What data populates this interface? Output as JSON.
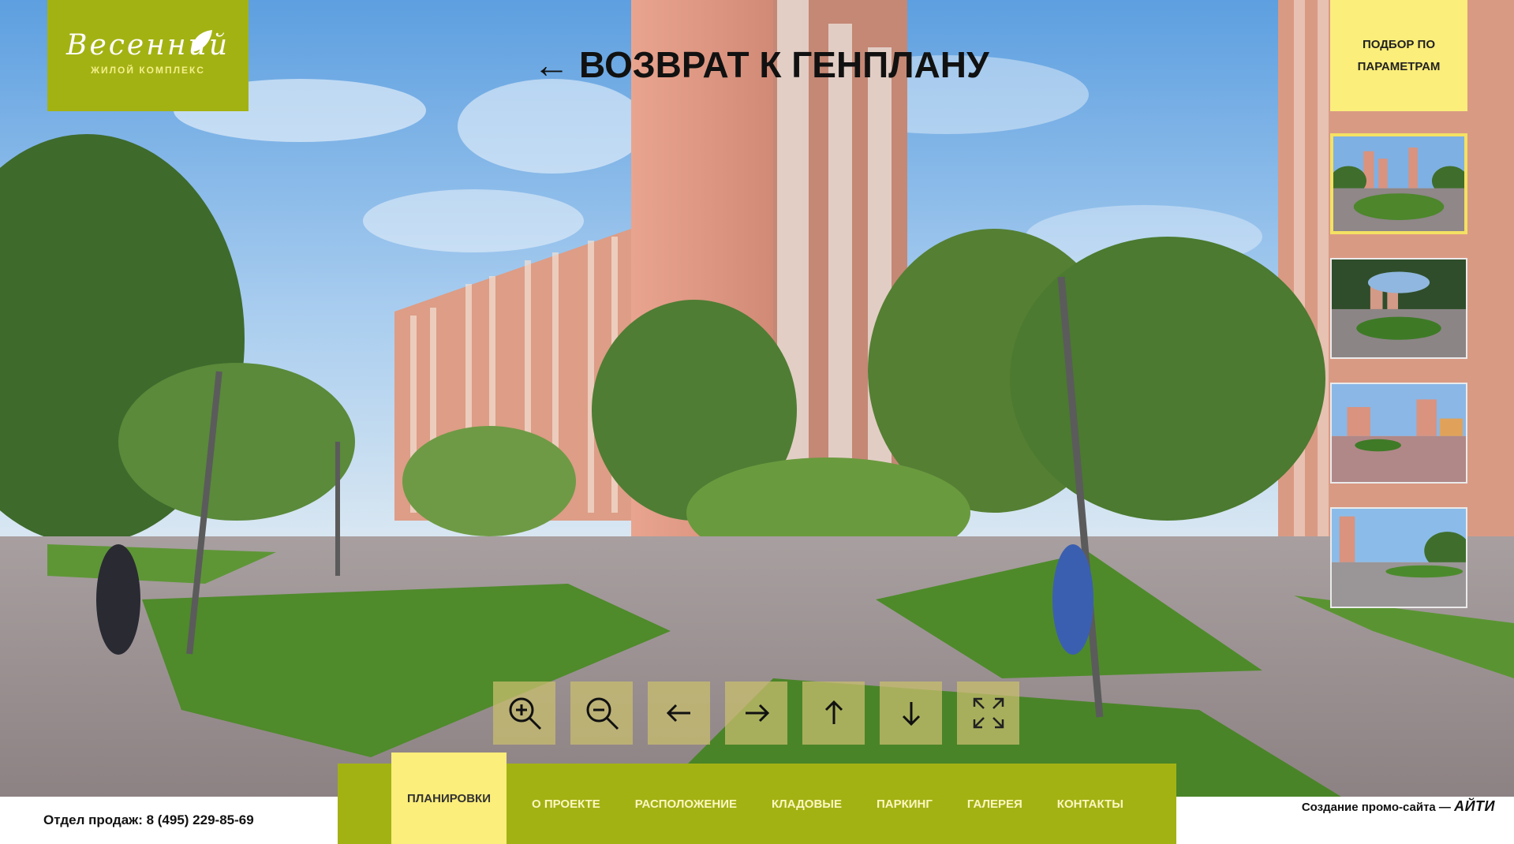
{
  "logo": {
    "brand": "Весенний",
    "subtitle": "ЖИЛОЙ КОМПЛЕКС"
  },
  "back_link": {
    "arrow": "←",
    "label": "ВОЗВРАТ К ГЕНПЛАНУ"
  },
  "filter_button": {
    "label": "ПОДБОР ПО ПАРАМЕТРАМ"
  },
  "thumbnails": [
    {
      "name": "panorama-1",
      "active": true
    },
    {
      "name": "panorama-2",
      "active": false
    },
    {
      "name": "panorama-3",
      "active": false
    },
    {
      "name": "panorama-4",
      "active": false
    }
  ],
  "controls": [
    {
      "name": "zoom-in",
      "icon": "zoom-in-icon"
    },
    {
      "name": "zoom-out",
      "icon": "zoom-out-icon"
    },
    {
      "name": "pan-left",
      "icon": "arrow-left-icon"
    },
    {
      "name": "pan-right",
      "icon": "arrow-right-icon"
    },
    {
      "name": "pan-up",
      "icon": "arrow-up-icon"
    },
    {
      "name": "pan-down",
      "icon": "arrow-down-icon"
    },
    {
      "name": "fullscreen",
      "icon": "fullscreen-icon"
    }
  ],
  "nav": {
    "items": [
      {
        "label": "ПЛАНИРОВКИ",
        "active": true
      },
      {
        "label": "О ПРОЕКТЕ"
      },
      {
        "label": "РАСПОЛОЖЕНИЕ"
      },
      {
        "label": "КЛАДОВЫЕ"
      },
      {
        "label": "ПАРКИНГ"
      },
      {
        "label": "ГАЛЕРЕЯ"
      },
      {
        "label": "КОНТАКТЫ"
      }
    ]
  },
  "footer": {
    "sales": "Отдел продаж: 8 (495) 229-85-69",
    "credits_text": "Создание промо-сайта —",
    "credits_brand": "АЙТИ"
  },
  "colors": {
    "brand_green": "#a3b213",
    "accent_yellow": "#fbee7a",
    "control_bg": "#c8be6e"
  }
}
